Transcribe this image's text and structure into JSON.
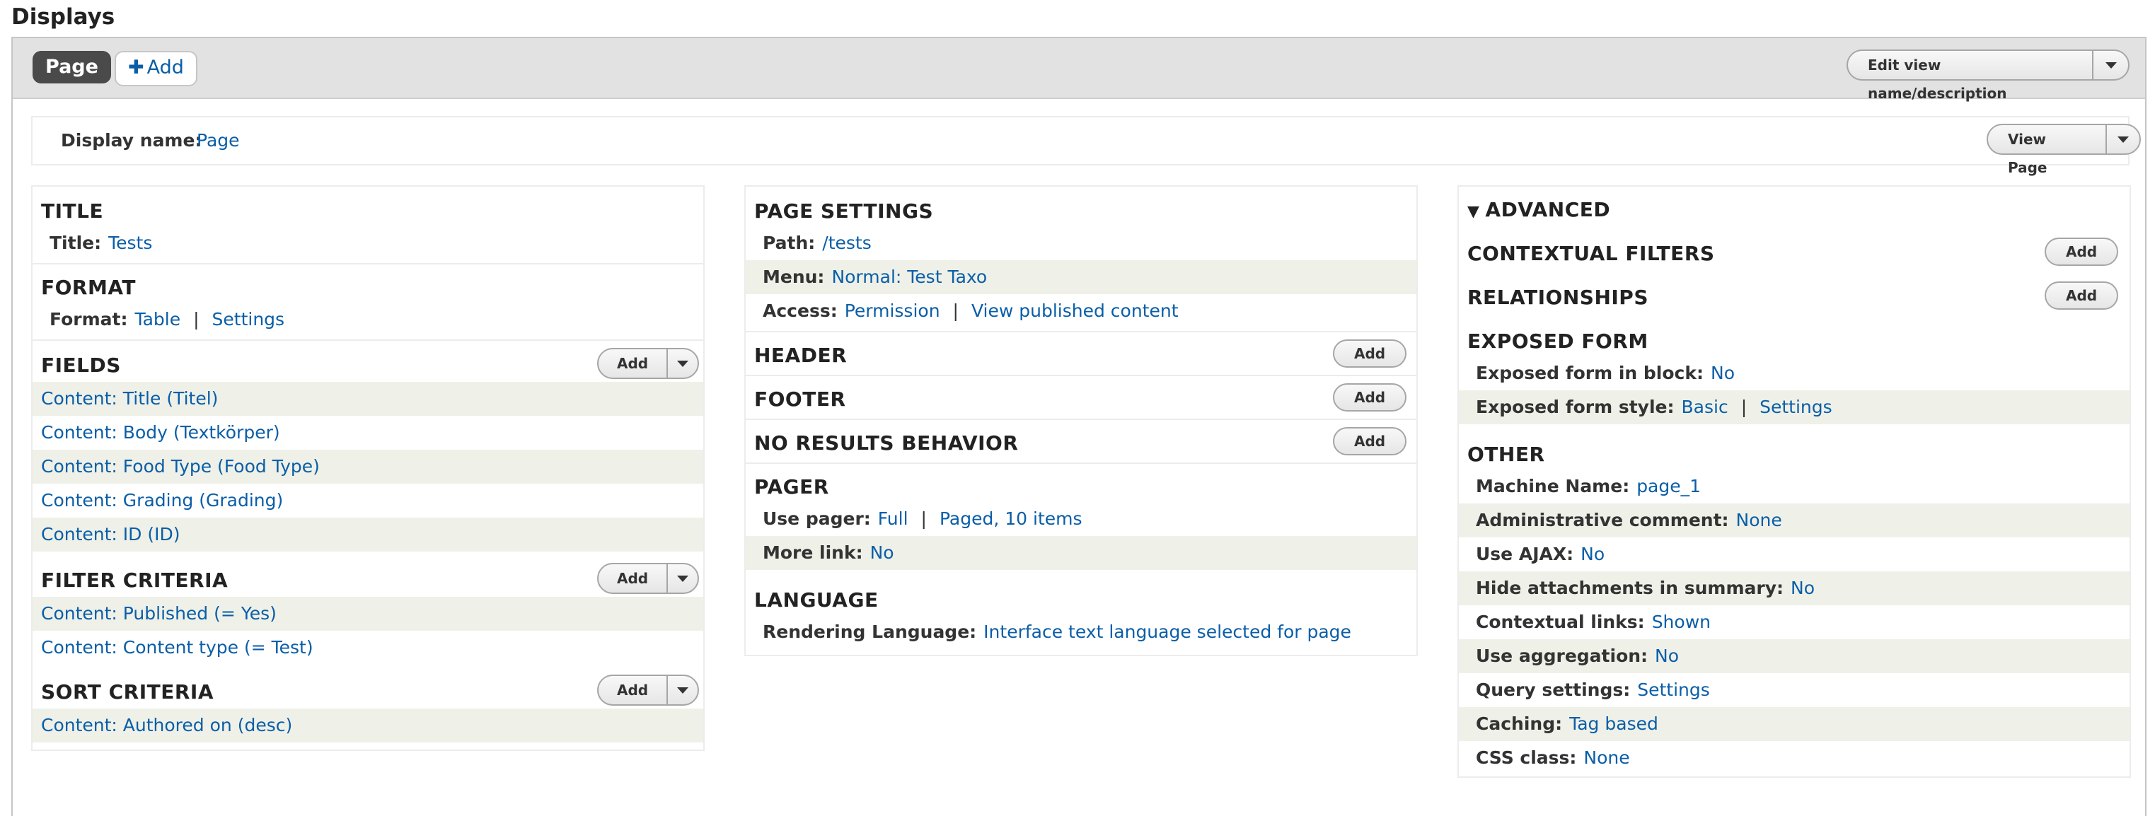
{
  "page_title": "Displays",
  "tabs": {
    "page": "Page",
    "add": "Add"
  },
  "edit_view_button": "Edit view name/description",
  "display_name": {
    "label": "Display name:",
    "value": "Page"
  },
  "view_page_button": "View Page",
  "left": {
    "title": {
      "heading": "TITLE",
      "label": "Title:",
      "value": "Tests"
    },
    "format": {
      "heading": "FORMAT",
      "label": "Format:",
      "value": "Table",
      "settings": "Settings"
    },
    "fields": {
      "heading": "FIELDS",
      "add": "Add",
      "items": [
        "Content: Title (Titel)",
        "Content: Body (Textkörper)",
        "Content: Food Type (Food Type)",
        "Content: Grading (Grading)",
        "Content: ID (ID)"
      ]
    },
    "filter": {
      "heading": "FILTER CRITERIA",
      "add": "Add",
      "items": [
        "Content: Published (= Yes)",
        "Content: Content type (= Test)"
      ]
    },
    "sort": {
      "heading": "SORT CRITERIA",
      "add": "Add",
      "items": [
        "Content: Authored on (desc)"
      ]
    }
  },
  "middle": {
    "page_settings": {
      "heading": "PAGE SETTINGS",
      "path_label": "Path:",
      "path": "/tests",
      "menu_label": "Menu:",
      "menu": "Normal: Test Taxo",
      "access_label": "Access:",
      "access": "Permission",
      "access_detail": "View published content"
    },
    "header": {
      "heading": "HEADER",
      "add": "Add"
    },
    "footer": {
      "heading": "FOOTER",
      "add": "Add"
    },
    "no_results": {
      "heading": "NO RESULTS BEHAVIOR",
      "add": "Add"
    },
    "pager": {
      "heading": "PAGER",
      "use_label": "Use pager:",
      "use": "Full",
      "paged": "Paged, 10 items",
      "more_label": "More link:",
      "more": "No"
    },
    "language": {
      "heading": "LANGUAGE",
      "label": "Rendering Language:",
      "value": "Interface text language selected for page"
    }
  },
  "right": {
    "advanced": "ADVANCED",
    "contextual": {
      "heading": "CONTEXTUAL FILTERS",
      "add": "Add"
    },
    "relationships": {
      "heading": "RELATIONSHIPS",
      "add": "Add"
    },
    "exposed": {
      "heading": "EXPOSED FORM",
      "block_label": "Exposed form in block:",
      "block": "No",
      "style_label": "Exposed form style:",
      "style": "Basic",
      "settings": "Settings"
    },
    "other": {
      "heading": "OTHER",
      "rows": [
        {
          "label": "Machine Name:",
          "value": "page_1"
        },
        {
          "label": "Administrative comment:",
          "value": "None"
        },
        {
          "label": "Use AJAX:",
          "value": "No"
        },
        {
          "label": "Hide attachments in summary:",
          "value": "No"
        },
        {
          "label": "Contextual links:",
          "value": "Shown"
        },
        {
          "label": "Use aggregation:",
          "value": "No"
        },
        {
          "label": "Query settings:",
          "value": "Settings"
        },
        {
          "label": "Caching:",
          "value": "Tag based"
        },
        {
          "label": "CSS class:",
          "value": "None"
        }
      ]
    }
  }
}
